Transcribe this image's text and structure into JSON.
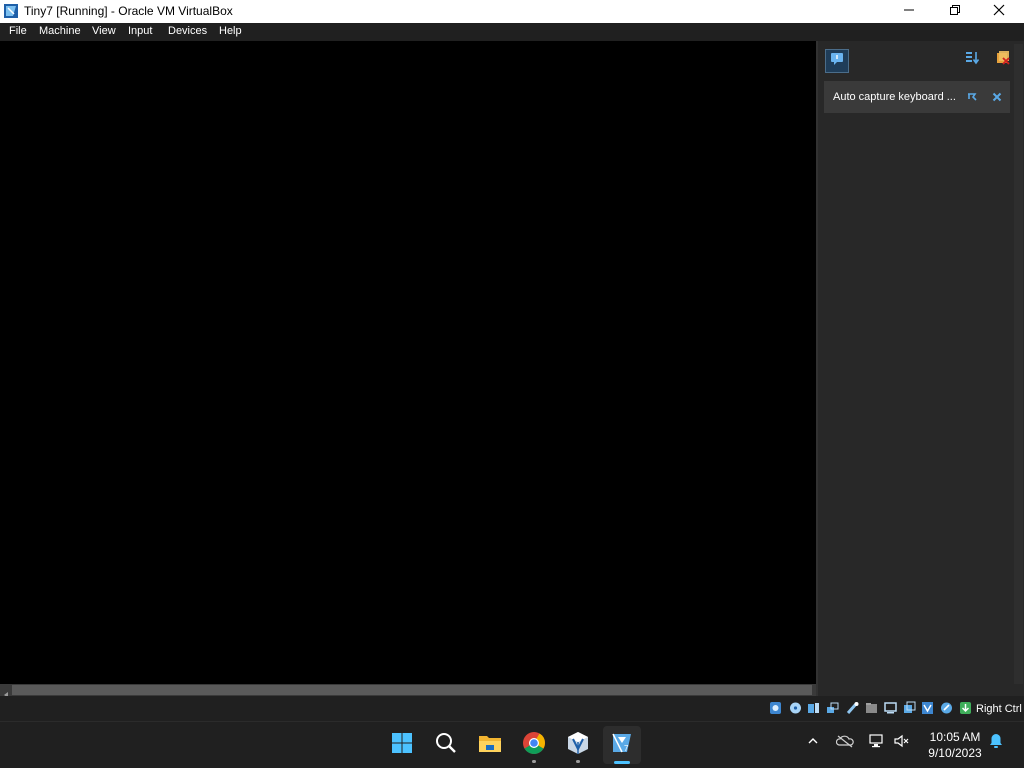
{
  "window": {
    "title": "Tiny7 [Running] - Oracle VM VirtualBox",
    "controls": [
      "minimize-icon",
      "maximize-icon",
      "close-icon"
    ]
  },
  "menu": {
    "items": [
      {
        "label": "File"
      },
      {
        "label": "Machine"
      },
      {
        "label": "View"
      },
      {
        "label": "Input"
      },
      {
        "label": "Devices"
      },
      {
        "label": "Help"
      }
    ]
  },
  "side_panel": {
    "toolbar_icons": [
      "message-icon",
      "sort-icon",
      "clear-all-icon"
    ],
    "notification": {
      "text": "Auto capture keyboard ...",
      "icons": [
        "pin-icon",
        "close-icon"
      ]
    }
  },
  "status_bar": {
    "icons": [
      "hard-disk-icon",
      "optical-drive-icon",
      "audio-icon",
      "network-icon",
      "usb-icon",
      "shared-folders-icon",
      "display-icon",
      "recording-icon",
      "cpu-icon",
      "mouse-integration-icon",
      "keyboard-capture-icon"
    ],
    "host_key": "Right Ctrl"
  },
  "taskbar": {
    "apps": [
      "start-icon",
      "search-icon",
      "file-explorer-icon",
      "chrome-icon",
      "virtualbox-manager-icon",
      "virtualbox-vm-icon"
    ],
    "tray_icons": [
      "chevron-up-icon",
      "onedrive-icon",
      "network-icon",
      "volume-muted-icon"
    ],
    "time": "10:05 AM",
    "date": "9/10/2023",
    "accent": "#4cc2ff"
  }
}
